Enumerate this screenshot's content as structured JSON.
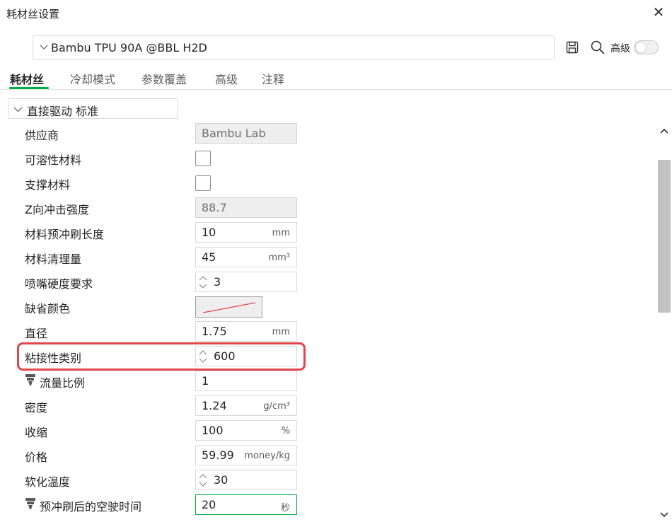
{
  "window": {
    "title": "耗材丝设置"
  },
  "preset": {
    "name": "Bambu TPU 90A @BBL H2D"
  },
  "toolbar": {
    "advanced_label": "高级",
    "advanced_enabled": false
  },
  "tabs": [
    {
      "label": "耗材丝",
      "active": true
    },
    {
      "label": "冷却模式",
      "active": false
    },
    {
      "label": "参数覆盖",
      "active": false
    },
    {
      "label": "高级",
      "active": false
    },
    {
      "label": "注释",
      "active": false
    }
  ],
  "group": {
    "label": "直接驱动 标准"
  },
  "rows": [
    {
      "label": "供应商",
      "value": "Bambu Lab",
      "unit": ""
    },
    {
      "label": "可溶性材料",
      "checked": false
    },
    {
      "label": "支撑材料",
      "checked": false
    },
    {
      "label": "Z向冲击强度",
      "value": "88.7",
      "unit": ""
    },
    {
      "label": "材料预冲刷长度",
      "value": "10",
      "unit": "mm"
    },
    {
      "label": "材料清理量",
      "value": "45",
      "unit": "mm³"
    },
    {
      "label": "喷嘴硬度要求",
      "value": "3",
      "unit": ""
    },
    {
      "label": "缺省颜色",
      "color": "#e2454a"
    },
    {
      "label": "直径",
      "value": "1.75",
      "unit": "mm"
    },
    {
      "label": "粘接性类别",
      "value": "600",
      "unit": ""
    },
    {
      "label": "流量比例",
      "value": "1",
      "unit": ""
    },
    {
      "label": "密度",
      "value": "1.24",
      "unit": "g/cm³"
    },
    {
      "label": "收缩",
      "value": "100",
      "unit": "%"
    },
    {
      "label": "价格",
      "value": "59.99",
      "unit": "money/kg"
    },
    {
      "label": "软化温度",
      "value": "30",
      "unit": ""
    },
    {
      "label": "预冲刷后的空驶时间",
      "value": "20",
      "unit": "秒"
    }
  ],
  "colors": {
    "accent": "#00ae42",
    "highlight": "#e2454a"
  }
}
